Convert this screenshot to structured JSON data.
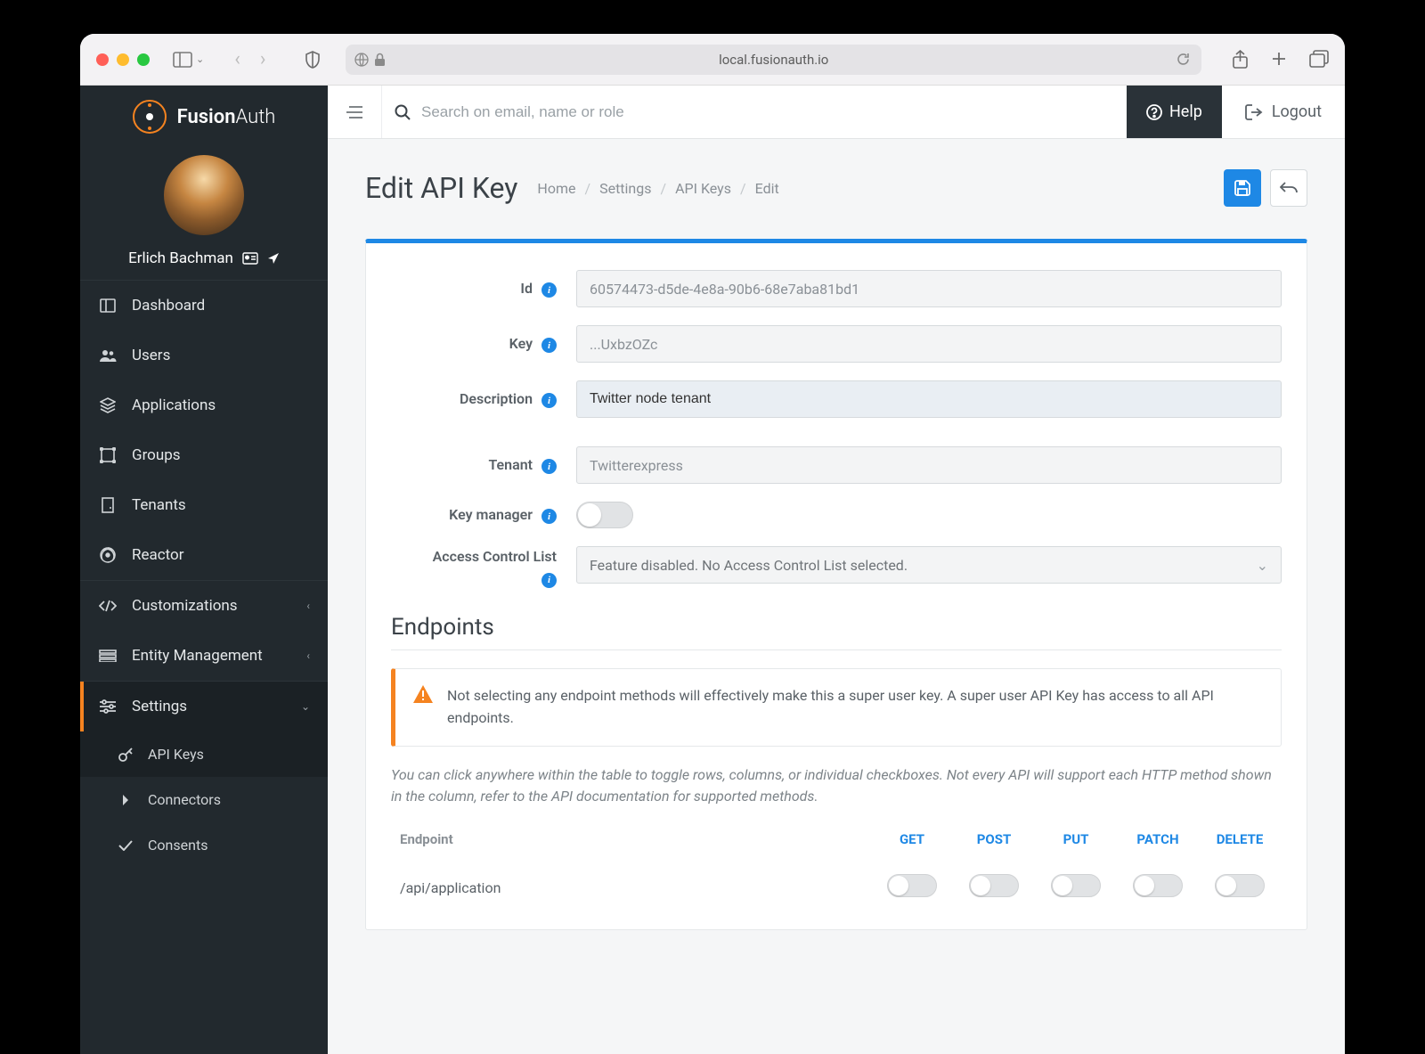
{
  "browser": {
    "url": "local.fusionauth.io"
  },
  "brand": {
    "name_a": "Fusion",
    "name_b": "Auth"
  },
  "user": {
    "name": "Erlich Bachman"
  },
  "sidebar": {
    "items": [
      {
        "label": "Dashboard"
      },
      {
        "label": "Users"
      },
      {
        "label": "Applications"
      },
      {
        "label": "Groups"
      },
      {
        "label": "Tenants"
      },
      {
        "label": "Reactor"
      },
      {
        "label": "Customizations"
      },
      {
        "label": "Entity Management"
      },
      {
        "label": "Settings"
      }
    ],
    "settings_sub": [
      {
        "label": "API Keys"
      },
      {
        "label": "Connectors"
      },
      {
        "label": "Consents"
      }
    ]
  },
  "topbar": {
    "search_placeholder": "Search on email, name or role",
    "help": "Help",
    "logout": "Logout"
  },
  "page": {
    "title": "Edit API Key",
    "breadcrumb": [
      "Home",
      "Settings",
      "API Keys",
      "Edit"
    ]
  },
  "form": {
    "labels": {
      "id": "Id",
      "key": "Key",
      "description": "Description",
      "tenant": "Tenant",
      "key_manager": "Key manager",
      "acl": "Access Control List"
    },
    "id_value": "60574473-d5de-4e8a-90b6-68e7aba81bd1",
    "key_value": "...UxbzOZc",
    "description_value": "Twitter node tenant",
    "tenant_value": "Twitterexpress",
    "acl_value": "Feature disabled. No Access Control List selected."
  },
  "endpoints": {
    "title": "Endpoints",
    "warning": "Not selecting any endpoint methods will effectively make this a super user key. A super user API Key has access to all API endpoints.",
    "hint": "You can click anywhere within the table to toggle rows, columns, or individual checkboxes. Not every API will support each HTTP method shown in the column, refer to the API documentation for supported methods.",
    "columns": {
      "endpoint": "Endpoint",
      "get": "GET",
      "post": "POST",
      "put": "PUT",
      "patch": "PATCH",
      "delete": "DELETE"
    },
    "rows": [
      {
        "path": "/api/application"
      }
    ]
  }
}
